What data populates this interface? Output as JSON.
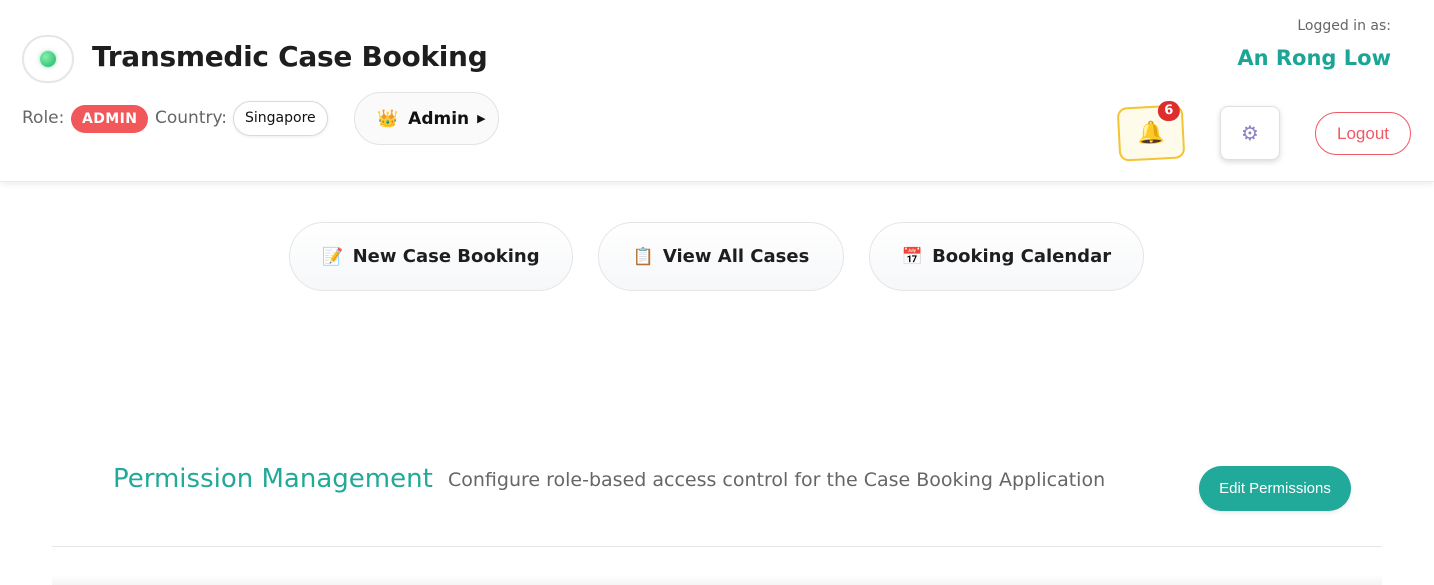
{
  "header": {
    "app_title": "Transmedic Case Booking",
    "role_label": "Role:",
    "role_value": "ADMIN",
    "country_label": "Country:",
    "country_value": "Singapore",
    "admin_menu_label": "Admin",
    "admin_menu_icon": "crown-icon",
    "logged_in_label": "Logged in as:",
    "user_name": "An Rong Low",
    "notification_count": "6",
    "logout_label": "Logout",
    "colors": {
      "role_badge": "#f2585a",
      "user_name": "#1ba596",
      "logout": "#ef5a66",
      "notif_border": "#f3c433"
    }
  },
  "nav": {
    "items": [
      {
        "label": "New Case Booking",
        "icon": "memo-icon"
      },
      {
        "label": "View All Cases",
        "icon": "clipboard-icon"
      },
      {
        "label": "Booking Calendar",
        "icon": "calendar-icon"
      }
    ]
  },
  "permissions": {
    "title": "Permission Management",
    "description": "Configure role-based access control for the Case Booking Application",
    "edit_button": "Edit Permissions",
    "accent_color": "#21a99a"
  }
}
